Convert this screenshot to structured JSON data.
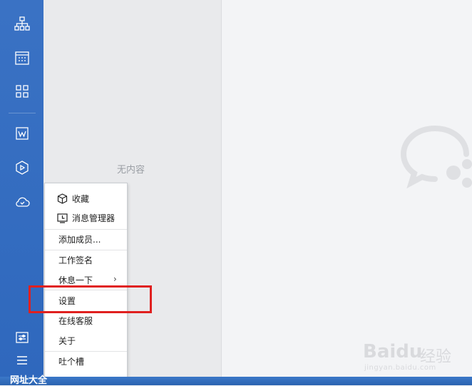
{
  "sidebar": {
    "icons": [
      "org-chart-icon",
      "calendar-icon",
      "apps-grid-icon",
      "document-icon",
      "box-icon",
      "cloud-icon"
    ],
    "bottom_icons": [
      "settings-sliders-icon",
      "hamburger-menu-icon"
    ]
  },
  "list_pane": {
    "empty_text": "无内容"
  },
  "menu": {
    "favorites": "收藏",
    "message_manager": "消息管理器",
    "add_member": "添加成员...",
    "work_signature": "工作签名",
    "take_break": "休息一下",
    "settings": "设置",
    "online_support": "在线客服",
    "about": "关于",
    "feedback": "吐个槽"
  },
  "taskbar": {
    "label": "网址大全"
  },
  "watermark": {
    "brand": "Baidu",
    "jingyan": "经验",
    "url": "jingyan.baidu.com"
  },
  "colors": {
    "sidebar": "#3a72c4",
    "highlight": "#e0201f"
  }
}
